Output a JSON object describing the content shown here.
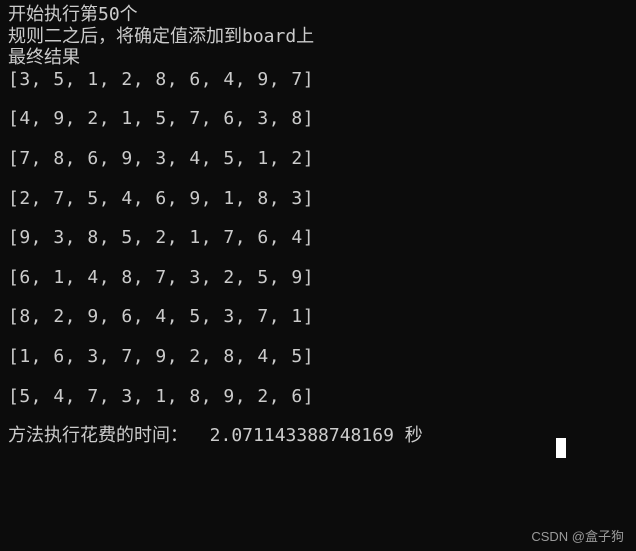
{
  "header": {
    "line1": "开始执行第50个",
    "line2": "规则二之后，将确定值添加到board上",
    "line3": "最终结果"
  },
  "matrix": {
    "row0": "[3, 5, 1, 2, 8, 6, 4, 9, 7]",
    "row1": "[4, 9, 2, 1, 5, 7, 6, 3, 8]",
    "row2": "[7, 8, 6, 9, 3, 4, 5, 1, 2]",
    "row3": "[2, 7, 5, 4, 6, 9, 1, 8, 3]",
    "row4": "[9, 3, 8, 5, 2, 1, 7, 6, 4]",
    "row5": "[6, 1, 4, 8, 7, 3, 2, 5, 9]",
    "row6": "[8, 2, 9, 6, 4, 5, 3, 7, 1]",
    "row7": "[1, 6, 3, 7, 9, 2, 8, 4, 5]",
    "row8": "[5, 4, 7, 3, 1, 8, 9, 2, 6]"
  },
  "footer": {
    "timing": "方法执行花费的时间：  2.071143388748169 秒"
  },
  "watermark": "CSDN @盒子狗"
}
